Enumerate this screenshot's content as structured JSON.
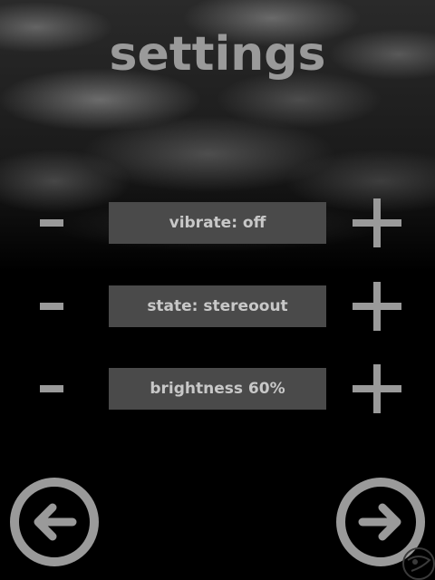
{
  "screen": {
    "title": "settings"
  },
  "settings": [
    {
      "label": "vibrate: off",
      "decrease_icon": "minus-icon",
      "increase_icon": "plus-icon"
    },
    {
      "label": "state: stereoout",
      "decrease_icon": "minus-icon",
      "increase_icon": "plus-icon"
    },
    {
      "label": "brightness 60%",
      "decrease_icon": "minus-icon",
      "increase_icon": "plus-icon"
    }
  ],
  "navigation": {
    "back_icon": "arrow-left-circle-icon",
    "next_icon": "arrow-right-circle-icon"
  },
  "colors": {
    "background": "#000000",
    "control_gray": "#9a9a9a",
    "field_background": "#4a4a4a",
    "field_text": "#c8c8c8"
  }
}
